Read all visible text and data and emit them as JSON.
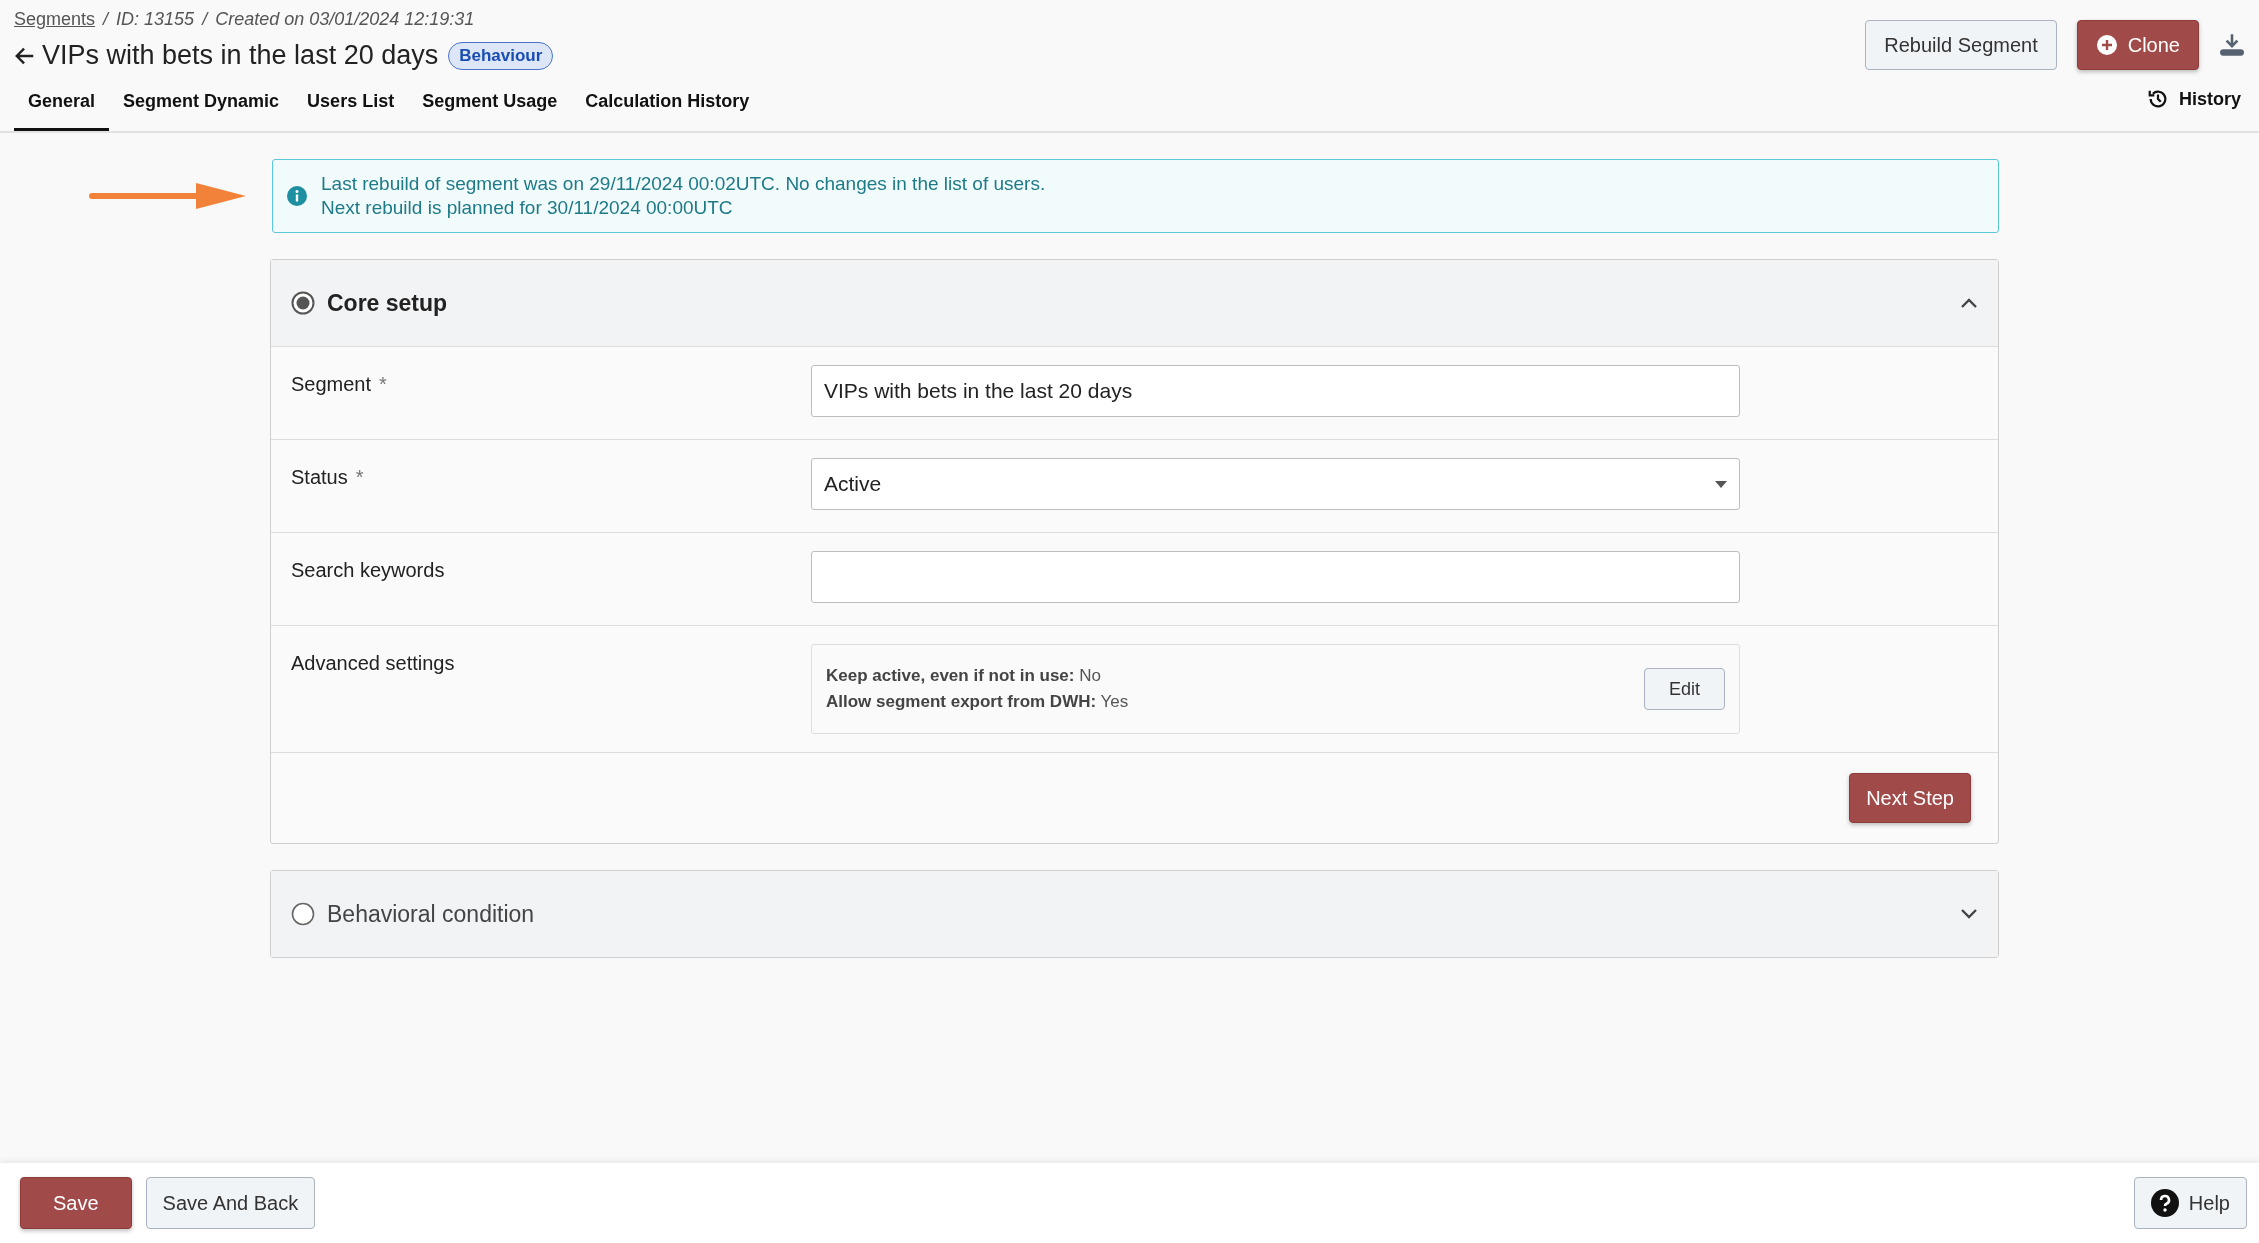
{
  "breadcrumb": {
    "link": "Segments",
    "separator_1": "/",
    "id": "ID: 13155",
    "separator_2": "/",
    "created": "Created on 03/01/2024 12:19:31"
  },
  "title": "VIPs with bets in the last 20 days",
  "badge": "Behaviour",
  "header_buttons": [
    {
      "kind": "secondary",
      "label": "Rebuild Segment"
    },
    {
      "kind": "primary",
      "label": "Clone"
    }
  ],
  "tabs": [
    {
      "label": "General",
      "selected": true
    },
    {
      "label": "Segment Dynamic",
      "selected": false
    },
    {
      "label": "Users List",
      "selected": false
    },
    {
      "label": "Segment Usage",
      "selected": false
    },
    {
      "label": "Calculation History",
      "selected": false
    }
  ],
  "history_link": "History",
  "info": {
    "lines": [
      "Last rebuild of segment was on 29/11/2024 00:02UTC. No changes in the list of users.",
      "Next rebuild is planned for 30/11/2024 00:00UTC"
    ]
  },
  "panels": [
    {
      "title": "Core setup",
      "selected": true,
      "expanded": true,
      "rows": [
        {
          "kind": "text",
          "label": "Segment",
          "asterisk": "*",
          "value": "VIPs with bets in the last 20 days"
        },
        {
          "kind": "select",
          "label": "Status",
          "asterisk": "*",
          "value": "Active"
        },
        {
          "kind": "text",
          "label": "Search keywords"
        },
        {
          "kind": "settings",
          "label": "Advanced settings",
          "settings": [
            {
              "name": "Keep active, even if not in use:",
              "value": "No"
            },
            {
              "name": "Allow segment export from DWH:",
              "value": "Yes"
            }
          ],
          "button": "Edit"
        }
      ],
      "next_button": "Next Step"
    },
    {
      "title": "Behavioral condition",
      "selected": false,
      "expanded": false
    }
  ],
  "footer": {
    "buttons": [
      {
        "kind": "primary",
        "label": "Save"
      },
      {
        "kind": "secondary",
        "label": "Save And Back"
      }
    ],
    "help": "Help"
  }
}
